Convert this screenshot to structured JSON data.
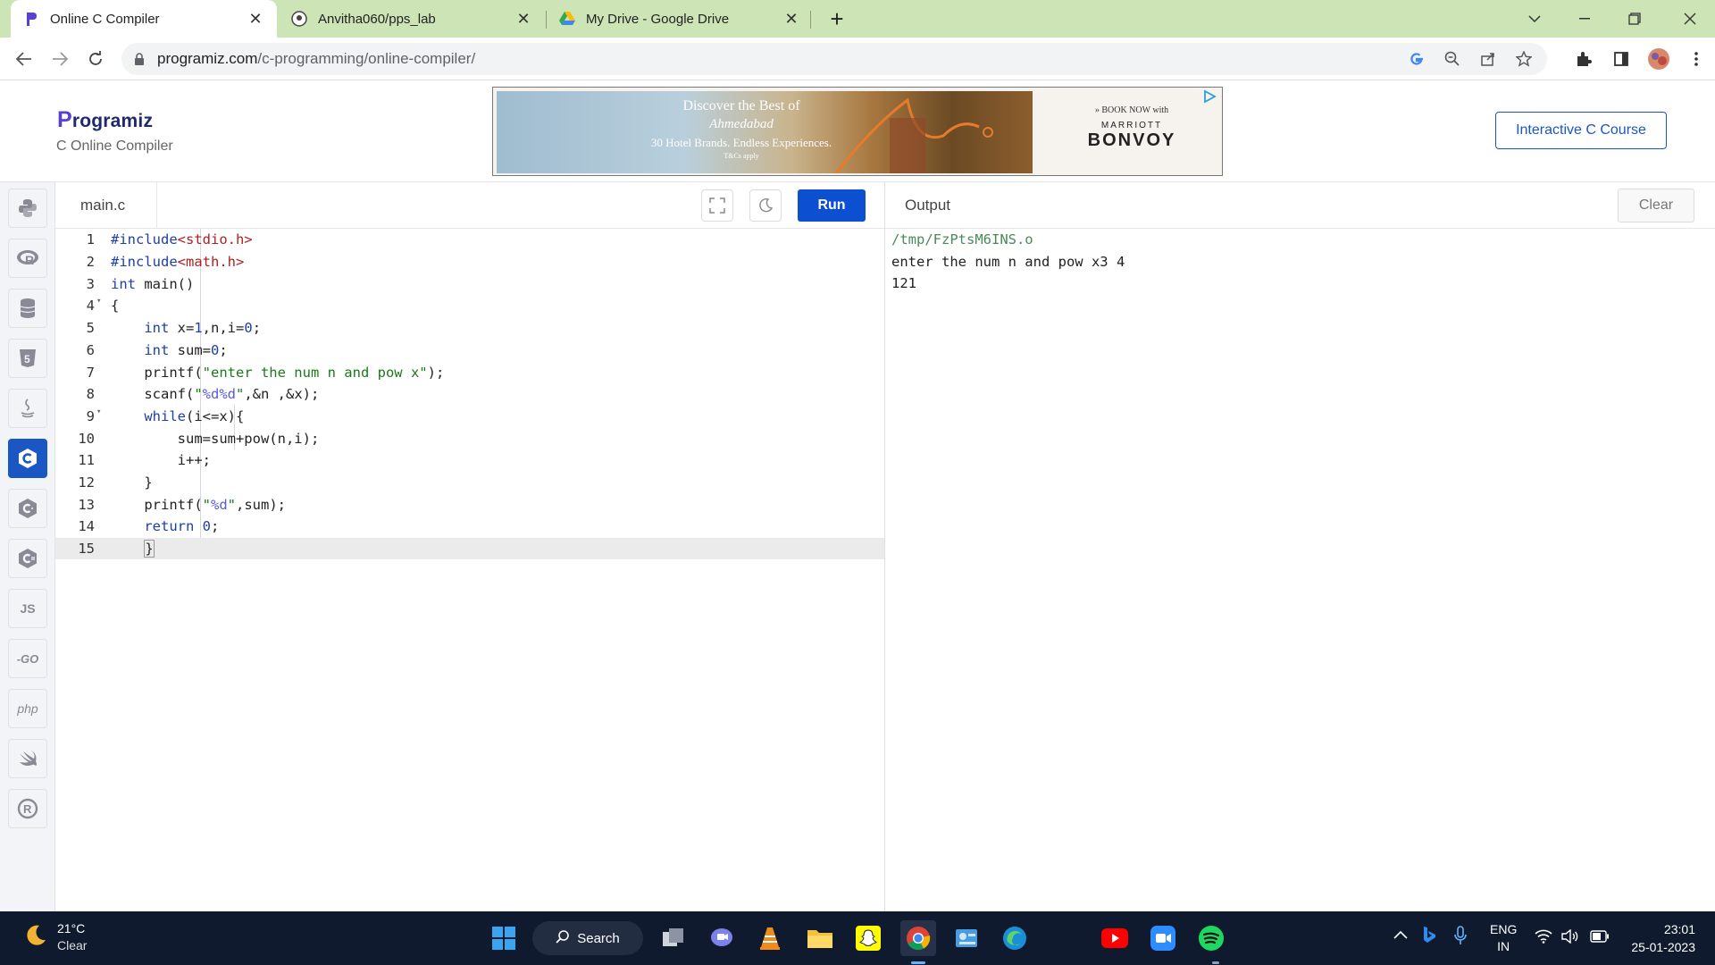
{
  "browser": {
    "tabs": [
      {
        "title": "Online C Compiler",
        "active": true
      },
      {
        "title": "Anvitha060/pps_lab",
        "active": false
      },
      {
        "title": "My Drive - Google Drive",
        "active": false
      }
    ],
    "url_host": "programiz.com",
    "url_path": "/c-programming/online-compiler/"
  },
  "header": {
    "logo_text": "rogramiz",
    "logo_initial": "P",
    "subtitle": "C Online Compiler",
    "course_button": "Interactive C Course"
  },
  "ad": {
    "line1": "Discover the Best of",
    "line2": "Ahmedabad",
    "line3": "30 Hotel Brands. Endless Experiences.",
    "line4": "T&Cs apply",
    "book": "» BOOK NOW with",
    "brand_top": "MARRIOTT",
    "brand_main": "BONVOY"
  },
  "sidebar": {
    "items": [
      {
        "name": "python",
        "glyph": "🐍"
      },
      {
        "name": "r",
        "glyph": "R"
      },
      {
        "name": "sql",
        "glyph": "≣"
      },
      {
        "name": "html",
        "glyph": "5"
      },
      {
        "name": "java",
        "glyph": "♨"
      },
      {
        "name": "c",
        "glyph": "C",
        "active": true
      },
      {
        "name": "cpp",
        "glyph": "C"
      },
      {
        "name": "csharp",
        "glyph": "C"
      },
      {
        "name": "js",
        "glyph": "JS"
      },
      {
        "name": "go",
        "glyph": "-GO"
      },
      {
        "name": "php",
        "glyph": "php"
      },
      {
        "name": "swift",
        "glyph": "➶"
      },
      {
        "name": "rust",
        "glyph": "R"
      }
    ]
  },
  "editor": {
    "filename": "main.c",
    "run_label": "Run",
    "lines": [
      "#include<stdio.h>",
      "#include<math.h>",
      "int main()",
      "{",
      "    int x=1,n,i=0;",
      "    int sum=0;",
      "    printf(\"enter the num n and pow x\");",
      "    scanf(\"%d%d\",&n ,&x);",
      "    while(i<=x){",
      "        sum=sum+pow(n,i);",
      "        i++;",
      "    }",
      "    printf(\"%d\",sum);",
      "    return 0;",
      "    }"
    ],
    "line_numbers": [
      "1",
      "2",
      "3",
      "4",
      "5",
      "6",
      "7",
      "8",
      "9",
      "10",
      "11",
      "12",
      "13",
      "14",
      "15"
    ],
    "current_line": 15
  },
  "output": {
    "title": "Output",
    "clear_label": "Clear",
    "lines": [
      "/tmp/FzPtsM6INS.o",
      "enter the num n and pow x3 4",
      "121"
    ]
  },
  "taskbar": {
    "temp": "21°C",
    "condition": "Clear",
    "search_label": "Search",
    "lang": "ENG",
    "region": "IN",
    "time": "23:01",
    "date": "25-01-2023"
  },
  "colors": {
    "accent": "#0c4fd0",
    "tabbar": "#cde4b6",
    "taskbar": "#0f1a2e"
  }
}
